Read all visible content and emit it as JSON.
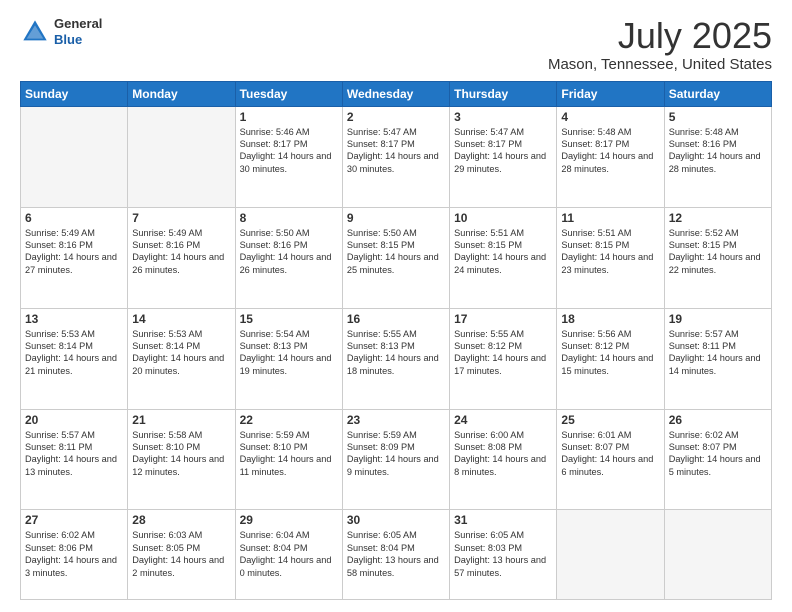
{
  "logo": {
    "general": "General",
    "blue": "Blue"
  },
  "header": {
    "title": "July 2025",
    "subtitle": "Mason, Tennessee, United States"
  },
  "days": [
    "Sunday",
    "Monday",
    "Tuesday",
    "Wednesday",
    "Thursday",
    "Friday",
    "Saturday"
  ],
  "weeks": [
    [
      {
        "day": "",
        "content": ""
      },
      {
        "day": "",
        "content": ""
      },
      {
        "day": "1",
        "content": "Sunrise: 5:46 AM\nSunset: 8:17 PM\nDaylight: 14 hours\nand 30 minutes."
      },
      {
        "day": "2",
        "content": "Sunrise: 5:47 AM\nSunset: 8:17 PM\nDaylight: 14 hours\nand 30 minutes."
      },
      {
        "day": "3",
        "content": "Sunrise: 5:47 AM\nSunset: 8:17 PM\nDaylight: 14 hours\nand 29 minutes."
      },
      {
        "day": "4",
        "content": "Sunrise: 5:48 AM\nSunset: 8:17 PM\nDaylight: 14 hours\nand 28 minutes."
      },
      {
        "day": "5",
        "content": "Sunrise: 5:48 AM\nSunset: 8:16 PM\nDaylight: 14 hours\nand 28 minutes."
      }
    ],
    [
      {
        "day": "6",
        "content": "Sunrise: 5:49 AM\nSunset: 8:16 PM\nDaylight: 14 hours\nand 27 minutes."
      },
      {
        "day": "7",
        "content": "Sunrise: 5:49 AM\nSunset: 8:16 PM\nDaylight: 14 hours\nand 26 minutes."
      },
      {
        "day": "8",
        "content": "Sunrise: 5:50 AM\nSunset: 8:16 PM\nDaylight: 14 hours\nand 26 minutes."
      },
      {
        "day": "9",
        "content": "Sunrise: 5:50 AM\nSunset: 8:15 PM\nDaylight: 14 hours\nand 25 minutes."
      },
      {
        "day": "10",
        "content": "Sunrise: 5:51 AM\nSunset: 8:15 PM\nDaylight: 14 hours\nand 24 minutes."
      },
      {
        "day": "11",
        "content": "Sunrise: 5:51 AM\nSunset: 8:15 PM\nDaylight: 14 hours\nand 23 minutes."
      },
      {
        "day": "12",
        "content": "Sunrise: 5:52 AM\nSunset: 8:15 PM\nDaylight: 14 hours\nand 22 minutes."
      }
    ],
    [
      {
        "day": "13",
        "content": "Sunrise: 5:53 AM\nSunset: 8:14 PM\nDaylight: 14 hours\nand 21 minutes."
      },
      {
        "day": "14",
        "content": "Sunrise: 5:53 AM\nSunset: 8:14 PM\nDaylight: 14 hours\nand 20 minutes."
      },
      {
        "day": "15",
        "content": "Sunrise: 5:54 AM\nSunset: 8:13 PM\nDaylight: 14 hours\nand 19 minutes."
      },
      {
        "day": "16",
        "content": "Sunrise: 5:55 AM\nSunset: 8:13 PM\nDaylight: 14 hours\nand 18 minutes."
      },
      {
        "day": "17",
        "content": "Sunrise: 5:55 AM\nSunset: 8:12 PM\nDaylight: 14 hours\nand 17 minutes."
      },
      {
        "day": "18",
        "content": "Sunrise: 5:56 AM\nSunset: 8:12 PM\nDaylight: 14 hours\nand 15 minutes."
      },
      {
        "day": "19",
        "content": "Sunrise: 5:57 AM\nSunset: 8:11 PM\nDaylight: 14 hours\nand 14 minutes."
      }
    ],
    [
      {
        "day": "20",
        "content": "Sunrise: 5:57 AM\nSunset: 8:11 PM\nDaylight: 14 hours\nand 13 minutes."
      },
      {
        "day": "21",
        "content": "Sunrise: 5:58 AM\nSunset: 8:10 PM\nDaylight: 14 hours\nand 12 minutes."
      },
      {
        "day": "22",
        "content": "Sunrise: 5:59 AM\nSunset: 8:10 PM\nDaylight: 14 hours\nand 11 minutes."
      },
      {
        "day": "23",
        "content": "Sunrise: 5:59 AM\nSunset: 8:09 PM\nDaylight: 14 hours\nand 9 minutes."
      },
      {
        "day": "24",
        "content": "Sunrise: 6:00 AM\nSunset: 8:08 PM\nDaylight: 14 hours\nand 8 minutes."
      },
      {
        "day": "25",
        "content": "Sunrise: 6:01 AM\nSunset: 8:07 PM\nDaylight: 14 hours\nand 6 minutes."
      },
      {
        "day": "26",
        "content": "Sunrise: 6:02 AM\nSunset: 8:07 PM\nDaylight: 14 hours\nand 5 minutes."
      }
    ],
    [
      {
        "day": "27",
        "content": "Sunrise: 6:02 AM\nSunset: 8:06 PM\nDaylight: 14 hours\nand 3 minutes."
      },
      {
        "day": "28",
        "content": "Sunrise: 6:03 AM\nSunset: 8:05 PM\nDaylight: 14 hours\nand 2 minutes."
      },
      {
        "day": "29",
        "content": "Sunrise: 6:04 AM\nSunset: 8:04 PM\nDaylight: 14 hours\nand 0 minutes."
      },
      {
        "day": "30",
        "content": "Sunrise: 6:05 AM\nSunset: 8:04 PM\nDaylight: 13 hours\nand 58 minutes."
      },
      {
        "day": "31",
        "content": "Sunrise: 6:05 AM\nSunset: 8:03 PM\nDaylight: 13 hours\nand 57 minutes."
      },
      {
        "day": "",
        "content": ""
      },
      {
        "day": "",
        "content": ""
      }
    ]
  ]
}
